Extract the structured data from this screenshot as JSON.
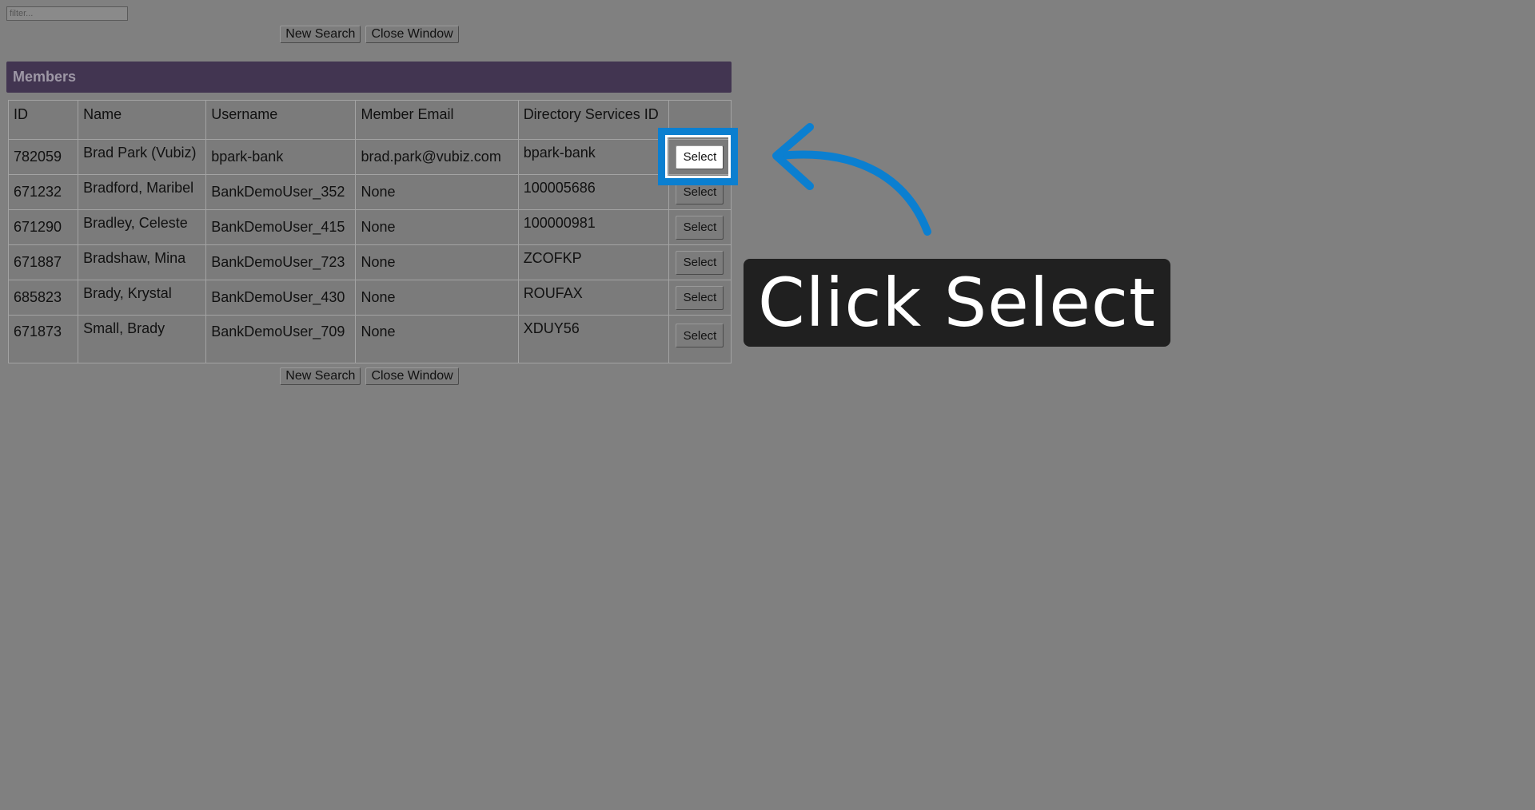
{
  "filter": {
    "placeholder": "filter..."
  },
  "actions": {
    "new_search": "New Search",
    "close_window": "Close Window"
  },
  "panel": {
    "title": "Members"
  },
  "table": {
    "columns": [
      "ID",
      "Name",
      "Username",
      "Member Email",
      "Directory Services ID",
      ""
    ],
    "select_label": "Select",
    "rows": [
      {
        "id": "782059",
        "name": "Brad Park (Vubiz)",
        "username": "bpark-bank",
        "email": "brad.park@vubiz.com",
        "ds_id": "bpark-bank"
      },
      {
        "id": "671232",
        "name": "Bradford, Maribel",
        "username": "BankDemoUser_352",
        "email": "None",
        "ds_id": "100005686"
      },
      {
        "id": "671290",
        "name": "Bradley, Celeste",
        "username": "BankDemoUser_415",
        "email": "None",
        "ds_id": "100000981"
      },
      {
        "id": "671887",
        "name": "Bradshaw, Mina",
        "username": "BankDemoUser_723",
        "email": "None",
        "ds_id": "ZCOFKP"
      },
      {
        "id": "685823",
        "name": "Brady, Krystal",
        "username": "BankDemoUser_430",
        "email": "None",
        "ds_id": "ROUFAX"
      },
      {
        "id": "671873",
        "name": "Small, Brady",
        "username": "BankDemoUser_709",
        "email": "None",
        "ds_id": "XDUY56"
      }
    ]
  },
  "annotation": {
    "text": "Click Select",
    "color": "#0b7fd0"
  }
}
